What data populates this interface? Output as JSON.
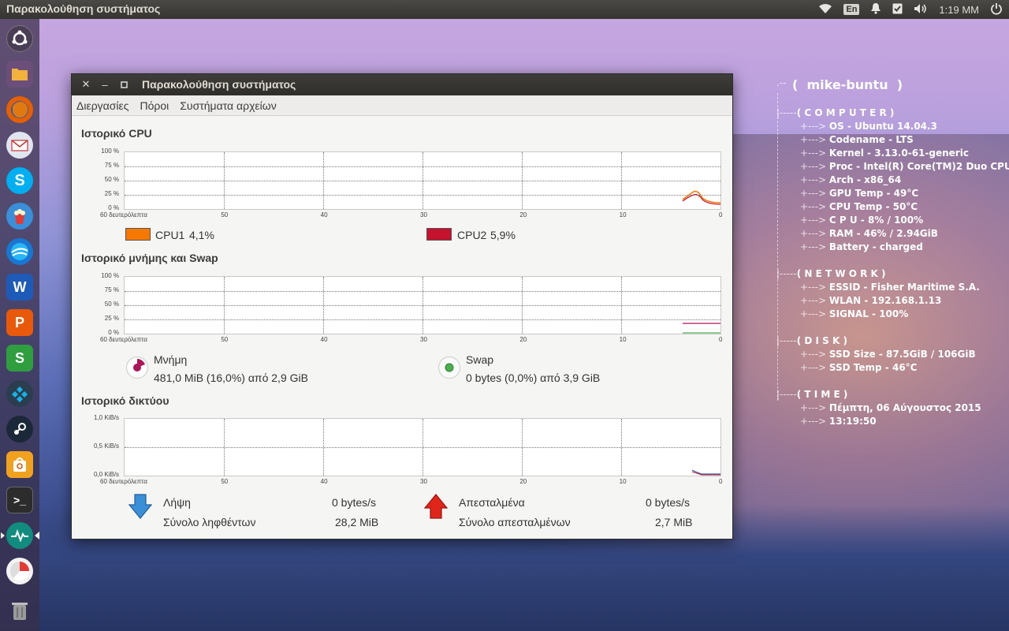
{
  "top_panel": {
    "title": "Παρακολούθηση συστήματος",
    "language": "En",
    "clock": "1:19 MM",
    "icons": [
      "wifi-icon",
      "bell-icon",
      "checklist-icon",
      "volume-icon",
      "power-icon"
    ]
  },
  "launcher": {
    "items": [
      "dash-icon",
      "files-icon",
      "firefox-icon",
      "mail-icon",
      "skype-icon",
      "popcorn-icon",
      "earth-icon",
      "writer-icon",
      "presentation-icon",
      "spreadsheet-icon",
      "kodi-icon",
      "steam-icon",
      "software-center-icon",
      "terminal-icon",
      "system-monitor-icon",
      "disk-usage-icon",
      "trash-icon"
    ]
  },
  "window": {
    "title": "Παρακολούθηση συστήματος",
    "menu": [
      "Διεργασίες",
      "Πόροι",
      "Συστήματα αρχείων"
    ],
    "cpu": {
      "heading": "Ιστορικό CPU",
      "cpu1_label": "CPU1",
      "cpu1_value": "4,1%",
      "cpu2_label": "CPU2",
      "cpu2_value": "5,9%",
      "cpu1_color": "#f57900",
      "cpu2_color": "#c4122f"
    },
    "memory": {
      "heading": "Ιστορικό μνήμης και Swap",
      "mem_label": "Μνήμη",
      "mem_value": "481,0 MiB (16,0%) από 2,9 GiB",
      "swap_label": "Swap",
      "swap_value": "0 bytes (0,0%) από 3,9 GiB",
      "mem_color": "#ad1457",
      "swap_color": "#4caf50"
    },
    "network": {
      "heading": "Ιστορικό δικτύου",
      "recv_label": "Λήψη",
      "recv_rate": "0 bytes/s",
      "recv_total_label": "Σύνολο ληφθέντων",
      "recv_total": "28,2 MiB",
      "sent_label": "Απεσταλμένα",
      "sent_rate": "0 bytes/s",
      "sent_total_label": "Σύνολο απεσταλμένων",
      "sent_total": "2,7 MiB"
    },
    "axis": {
      "x_ticks": [
        "60 δευτερόλεπτα",
        "50",
        "40",
        "30",
        "20",
        "10",
        "0"
      ],
      "pct_ticks": [
        "100 %",
        "75 %",
        "50 %",
        "25 %",
        "0 %"
      ],
      "net_ticks": [
        "1,0 KiB/s",
        "0,5 KiB/s",
        "0,0 KiB/s"
      ]
    }
  },
  "conky": {
    "host": "mike-buntu",
    "sections": [
      {
        "title": "( C O M P U T E R )",
        "items": [
          "OS - Ubuntu 14.04.3",
          "Codename - LTS",
          "Kernel - 3.13.0-61-generic",
          "Proc -  Intel(R) Core(TM)2 Duo CPU",
          "Arch - x86_64",
          "GPU Temp - 49°C",
          "CPU Temp - 50°C",
          "C P U - 8% / 100%",
          "RAM - 46% / 2.94GiB",
          "Battery - charged"
        ]
      },
      {
        "title": "( N E T W O R K )",
        "items": [
          "ESSID - Fisher Maritime S.A.",
          "WLAN - 192.168.1.13",
          "SIGNAL - 100%"
        ]
      },
      {
        "title": "( D I S K )",
        "items": [
          "SSD Size - 87.5GiB / 106GiB",
          "SSD Temp - 46°C"
        ]
      },
      {
        "title": "( T I M E )",
        "items": [
          "Πέμπτη, 06 Αύγουστος 2015",
          "13:19:50"
        ]
      }
    ]
  }
}
